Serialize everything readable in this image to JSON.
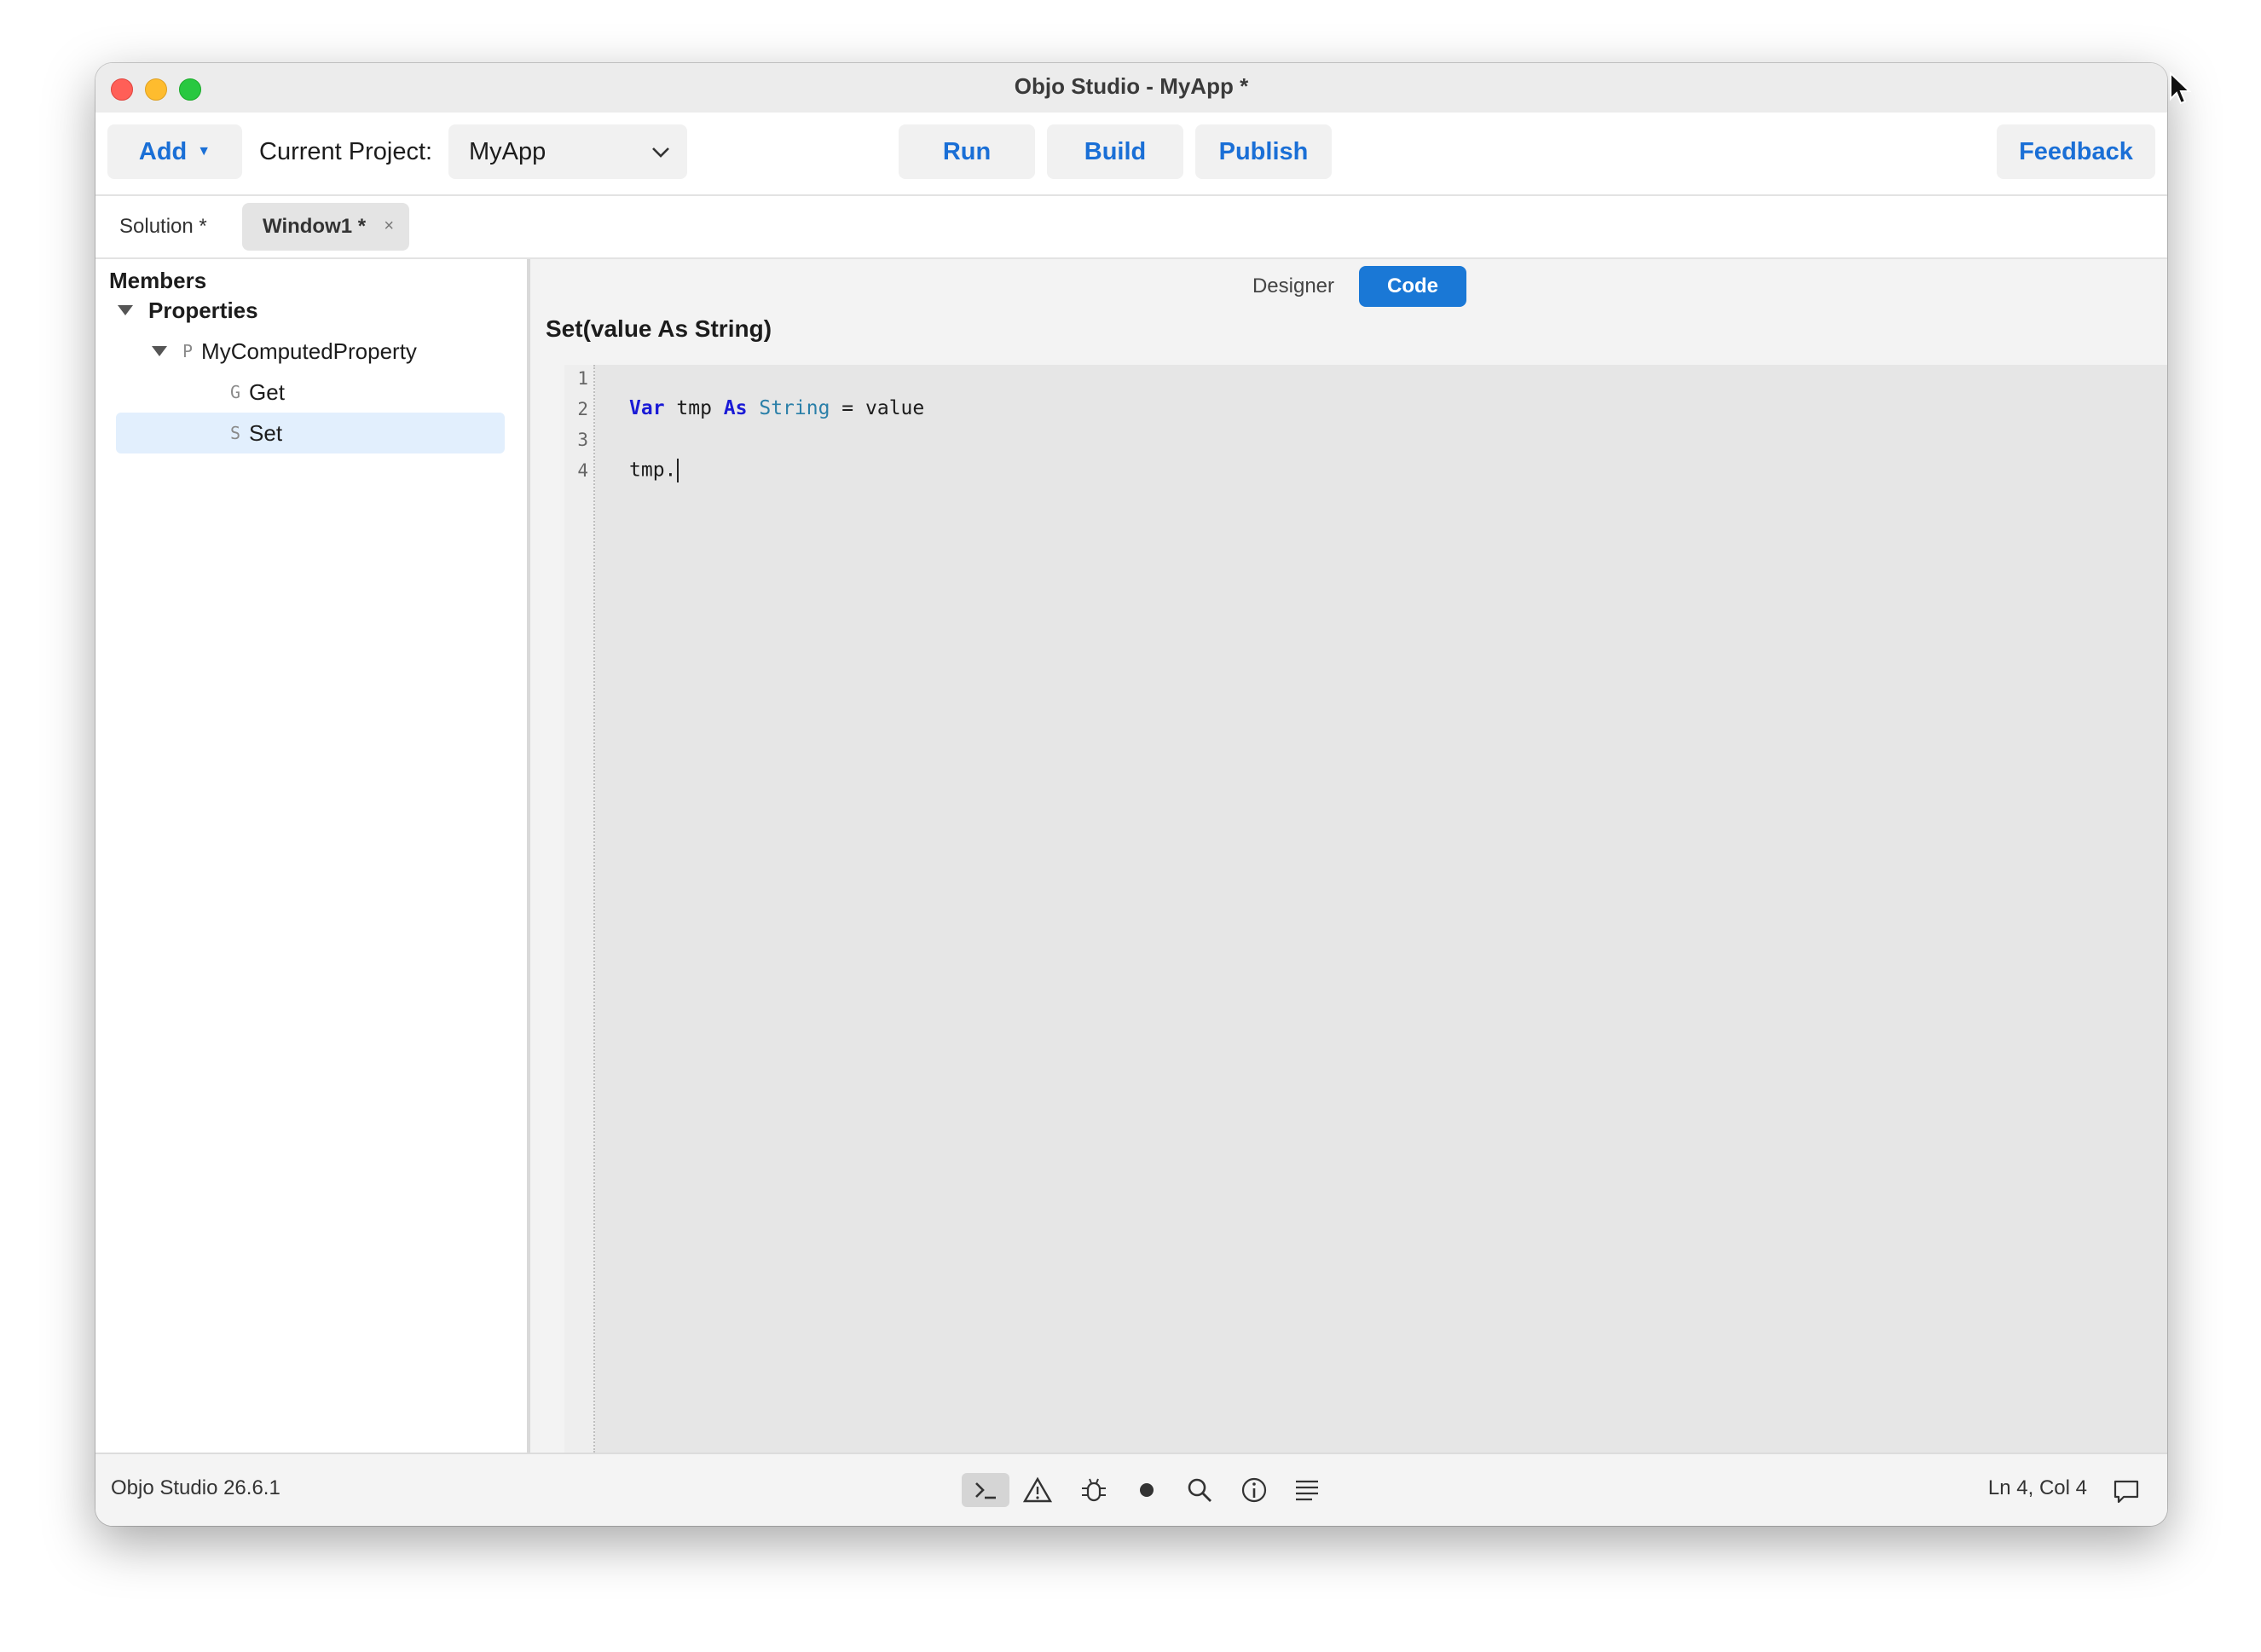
{
  "window": {
    "title": "Objo Studio - MyApp *"
  },
  "toolbar": {
    "add_label": "Add",
    "current_project_label": "Current Project:",
    "project_value": "MyApp",
    "run_label": "Run",
    "build_label": "Build",
    "publish_label": "Publish",
    "feedback_label": "Feedback"
  },
  "tabs": {
    "solution_label": "Solution *",
    "window_label": "Window1 *",
    "close_glyph": "×"
  },
  "sidebar": {
    "title": "Members",
    "properties_label": "Properties",
    "property": {
      "kind": "P",
      "name": "MyComputedProperty"
    },
    "get": {
      "kind": "G",
      "name": "Get"
    },
    "set": {
      "kind": "S",
      "name": "Set"
    }
  },
  "editor": {
    "designer_label": "Designer",
    "code_label": "Code",
    "method_signature": "Set(value As String)",
    "line_numbers": [
      "1",
      "2",
      "3",
      "4"
    ],
    "line2": {
      "kw1": "Var",
      "ident": " tmp ",
      "kw2": "As",
      "space": " ",
      "type": "String",
      "rest": " = value"
    },
    "line4": "tmp."
  },
  "status": {
    "version": "Objo Studio 26.6.1",
    "position": "Ln 4, Col 4",
    "icons": [
      "terminal-icon",
      "warning-icon",
      "bug-icon",
      "record-icon",
      "search-icon",
      "info-icon",
      "list-icon",
      "chat-icon"
    ]
  }
}
